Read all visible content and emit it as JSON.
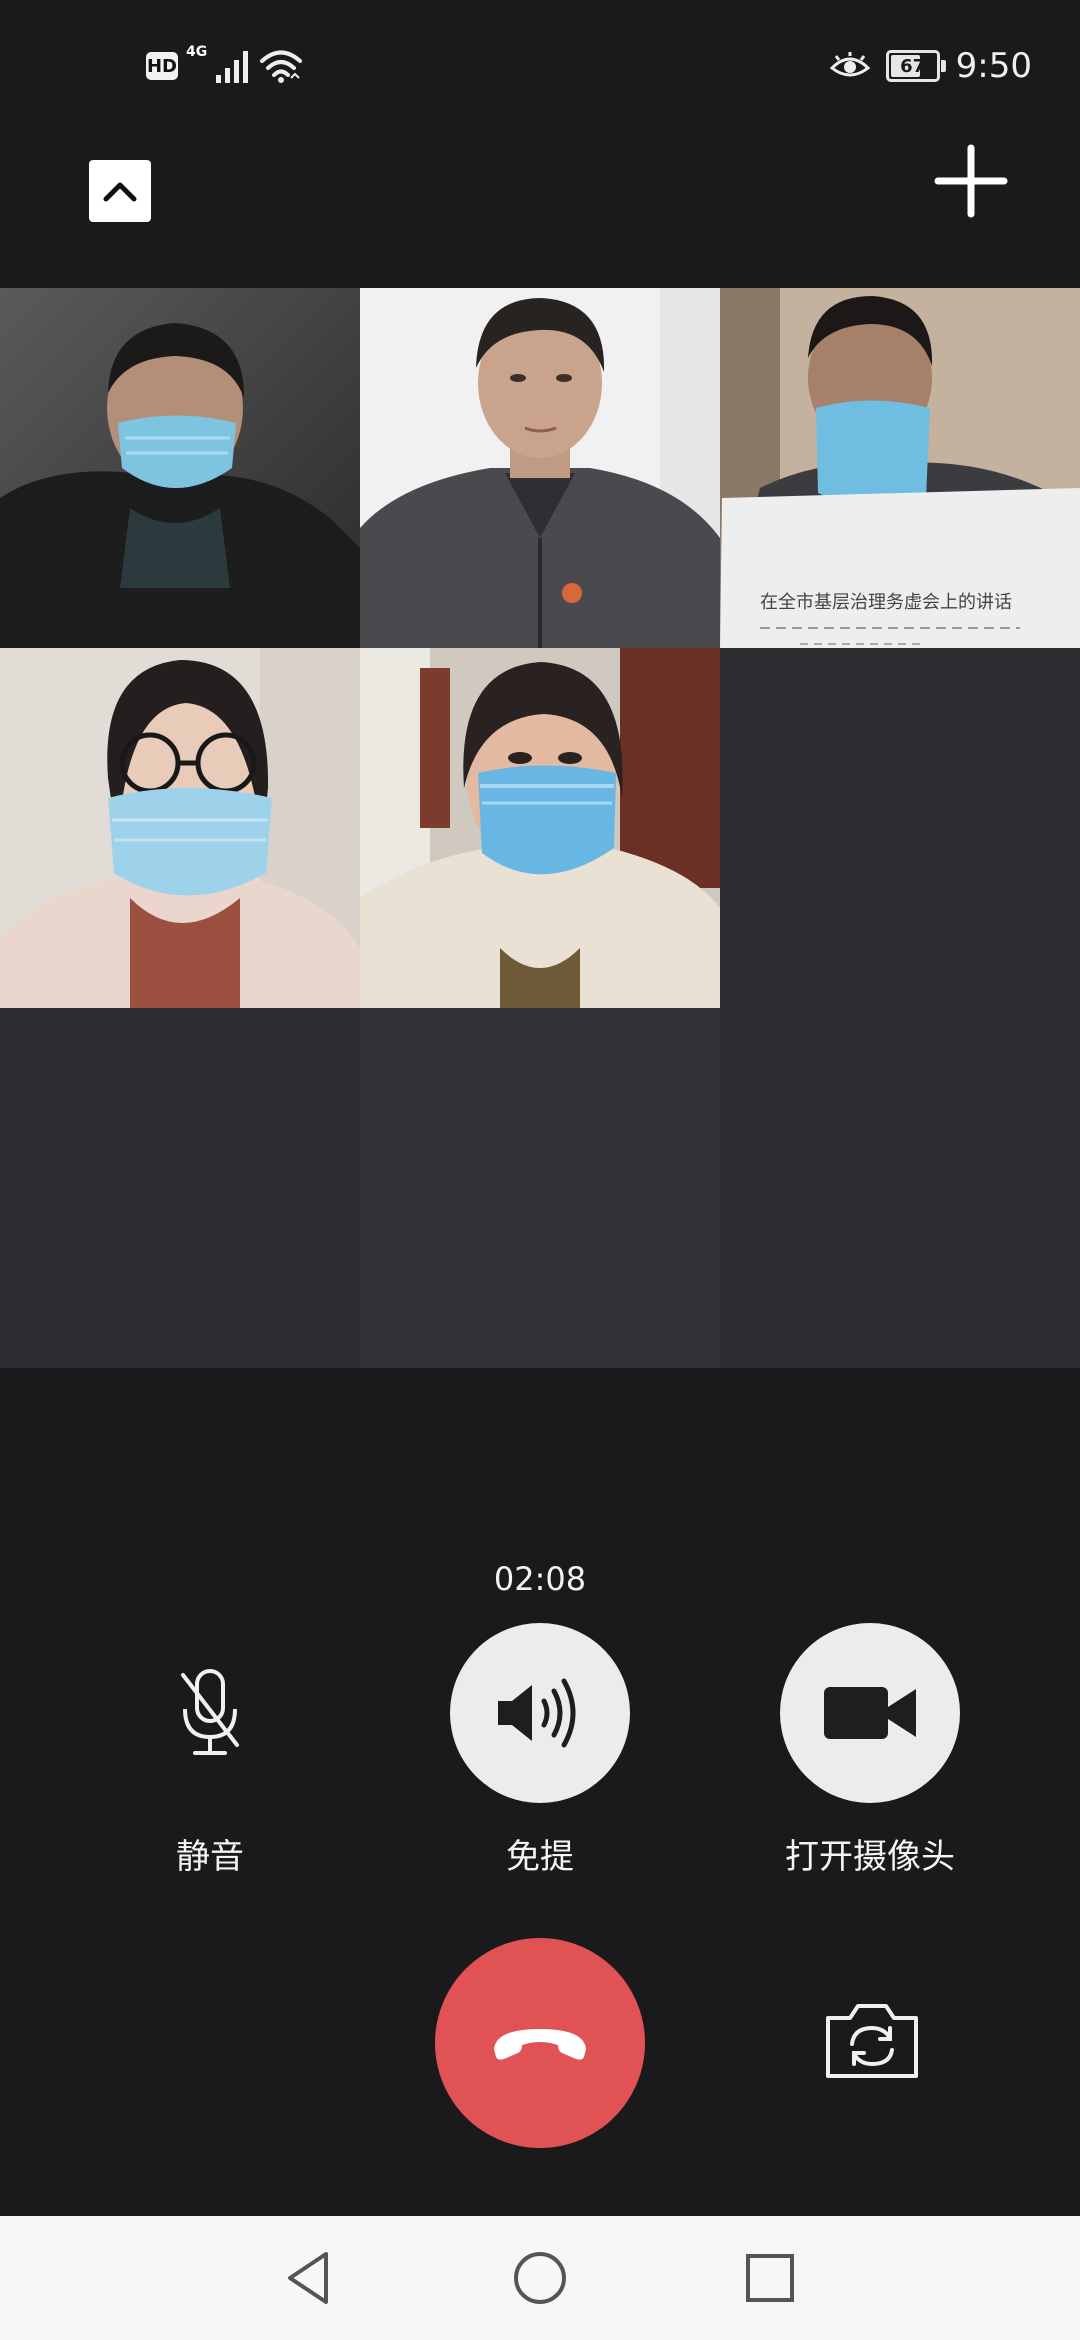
{
  "status_bar": {
    "hd_label": "HD",
    "network_type": "4G",
    "battery_level": "67",
    "battery_fraction": 0.67,
    "time": "9:50",
    "icons": [
      "signal-icon",
      "wifi-icon",
      "eye-comfort-icon",
      "battery-icon"
    ]
  },
  "top_bar": {
    "collapse_icon": "chevron-up-icon",
    "add_icon": "plus-icon"
  },
  "video_grid": {
    "participants": [
      {
        "id": "p1",
        "camera": "on"
      },
      {
        "id": "p2",
        "camera": "on"
      },
      {
        "id": "p3",
        "camera": "on",
        "document_text_line1": "在全市基层治理务虚会上的讲话"
      },
      {
        "id": "p4",
        "camera": "on"
      },
      {
        "id": "p5",
        "camera": "on"
      },
      {
        "id": "p6",
        "camera": "off"
      },
      {
        "id": "p7",
        "camera": "off"
      },
      {
        "id": "p8",
        "camera": "off"
      },
      {
        "id": "p9",
        "camera": "off"
      }
    ]
  },
  "call": {
    "duration": "02:08"
  },
  "controls": {
    "mute": {
      "label": "静音",
      "icon": "mic-off-icon"
    },
    "speaker": {
      "label": "免提",
      "icon": "speaker-icon"
    },
    "camera": {
      "label": "打开摄像头",
      "icon": "video-camera-icon"
    },
    "hangup": {
      "icon": "phone-hangup-icon",
      "color": "#e05254"
    },
    "switch_camera": {
      "icon": "camera-switch-icon"
    }
  },
  "nav_bar": {
    "icons": [
      "back-triangle-icon",
      "home-circle-icon",
      "recents-square-icon"
    ]
  }
}
